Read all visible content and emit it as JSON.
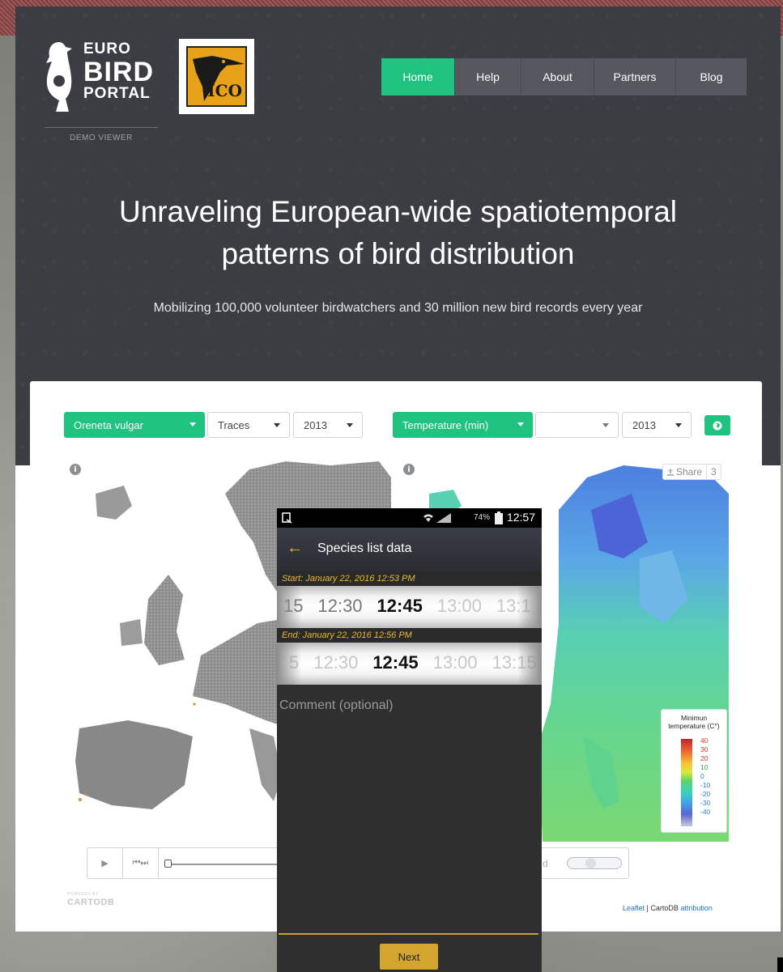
{
  "logo": {
    "line1": "EURO",
    "line2": "BIRD",
    "line3": "PORTAL",
    "tagline": "DEMO VIEWER"
  },
  "partner_badge": {
    "text": "ICO"
  },
  "nav": {
    "items": [
      {
        "label": "Home",
        "active": true
      },
      {
        "label": "Help",
        "active": false
      },
      {
        "label": "About",
        "active": false
      },
      {
        "label": "Partners",
        "active": false
      },
      {
        "label": "Blog",
        "active": false
      }
    ]
  },
  "hero": {
    "title_line1": "Unraveling European-wide spatiotemporal",
    "title_line2": "patterns of bird distribution",
    "subtitle": "Mobilizing 100,000 volunteer birdwatchers and 30 million new bird records every year"
  },
  "controls": {
    "species": "Oreneta vulgar",
    "layer": "Traces",
    "year_left": "2013",
    "variable": "Temperature (min)",
    "variable_option": "",
    "year_right": "2013"
  },
  "map_right": {
    "share_label": "Share",
    "share_count": "3",
    "legend_title": "Minimun temperature (C°)",
    "legend_ticks": [
      "40",
      "30",
      "20",
      "10",
      "0",
      "-10",
      "-20",
      "-30",
      "-40"
    ]
  },
  "footer": {
    "powered_line1": "POWERED BY",
    "powered_line2": "CARTODB",
    "attrib_leaflet": "Leaflet",
    "attrib_sep": " | CartoDB ",
    "attrib_link": "attribution",
    "player_hidden_fragment": "d"
  },
  "phone": {
    "status_battery": "74%",
    "status_time": "12:57",
    "title": "Species list data",
    "start_label": "Start: January 22, 2016 12:53 PM",
    "start_wheel": [
      "15",
      "12:30",
      "12:45",
      "13:00",
      "13:1"
    ],
    "end_label": "End: January 22, 2016 12:56 PM",
    "end_wheel": [
      "5",
      "12:30",
      "12:45",
      "13:00",
      "13:15"
    ],
    "comment_placeholder": "Comment (optional)",
    "next_label": "Next"
  },
  "colors": {
    "accent_green": "#1fc27e",
    "header_dark": "#3b3d43",
    "phone_gold": "#d3a52e"
  }
}
